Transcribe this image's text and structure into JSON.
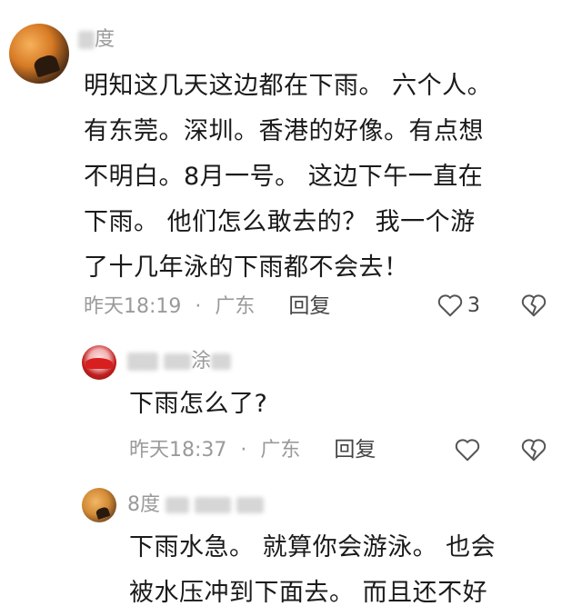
{
  "comments": [
    {
      "username_visible": "度",
      "text_lines": [
        "明知这几天这边都在下雨。 六个人。",
        "有东莞。深圳。香港的好像。有点想",
        "不明白。8月一号。 这边下午一直在",
        "下雨。 他们怎么敢去的？   我一个游",
        "了十几年泳的下雨都不会去！"
      ],
      "time": "昨天18:19",
      "separator": "·",
      "location": "广东",
      "reply_label": "回复",
      "like_count": "3"
    },
    {
      "username_visible": "涂",
      "text_lines": [
        "下雨怎么了?"
      ],
      "time": "昨天18:37",
      "separator": "·",
      "location": "广东",
      "reply_label": "回复"
    },
    {
      "username_visible": "8度",
      "text_lines": [
        "下雨水急。 就算你会游泳。 也会",
        "被水压冲到下面去。 而且还不好"
      ]
    }
  ],
  "colors": {
    "text": "#1a1a1a",
    "meta": "#9a9a9a",
    "icon": "#555555"
  },
  "icons": [
    "heart-outline-icon",
    "broken-heart-icon"
  ]
}
